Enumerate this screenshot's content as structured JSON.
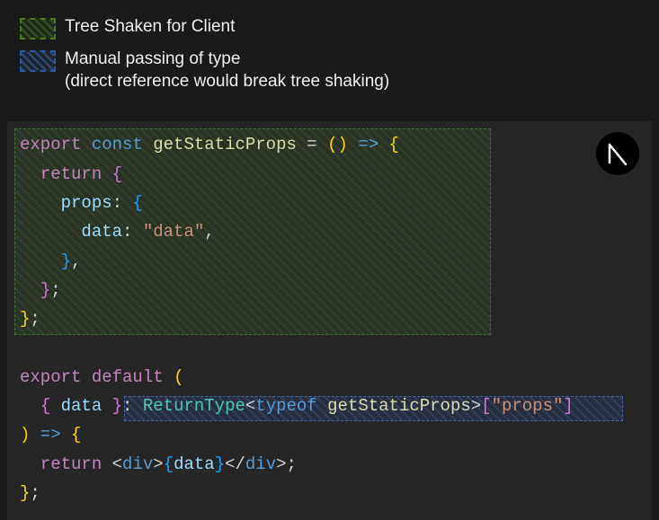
{
  "legend": {
    "green": "Tree Shaken for Client",
    "blue_line1": "Manual passing of type",
    "blue_line2": "(direct reference would break tree shaking)"
  },
  "code": {
    "l1_export": "export",
    "l1_const": "const",
    "l1_name": "getStaticProps",
    "l1_eq": " = ",
    "l1_parens": "()",
    "l1_arrow": " => ",
    "l1_brace": "{",
    "l2_indent": "  ",
    "l2_return": "return",
    "l2_sp": " ",
    "l2_brace": "{",
    "l3_indent": "    ",
    "l3_prop": "props",
    "l3_colon": ": ",
    "l3_brace": "{",
    "l4_indent": "      ",
    "l4_prop": "data",
    "l4_colon": ": ",
    "l4_str": "\"data\"",
    "l4_comma": ",",
    "l5_indent": "    ",
    "l5_brace": "}",
    "l5_comma": ",",
    "l6_indent": "  ",
    "l6_brace": "}",
    "l6_semi": ";",
    "l7_brace": "}",
    "l7_semi": ";",
    "l9_export": "export",
    "l9_default": "default",
    "l9_sp": " ",
    "l9_paren": "(",
    "l10_indent": "  ",
    "l10_brace_o": "{ ",
    "l10_data": "data",
    "l10_brace_c": " }",
    "l10_colon": ": ",
    "l10_ret": "ReturnType",
    "l10_lt": "<",
    "l10_typeof": "typeof",
    "l10_sp2": " ",
    "l10_gsp": "getStaticProps",
    "l10_gt": ">",
    "l10_br1": "[",
    "l10_props": "\"props\"",
    "l10_br2": "]",
    "l11_paren": ")",
    "l11_arrow": " => ",
    "l11_brace": "{",
    "l12_indent": "  ",
    "l12_return": "return",
    "l12_sp": " ",
    "l12_lt": "<",
    "l12_div": "div",
    "l12_gt": ">",
    "l12_bo": "{",
    "l12_data": "data",
    "l12_bc": "}",
    "l12_lt2": "</",
    "l12_div2": "div",
    "l12_gt2": ">",
    "l12_semi": ";",
    "l13_brace": "}",
    "l13_semi": ";"
  }
}
